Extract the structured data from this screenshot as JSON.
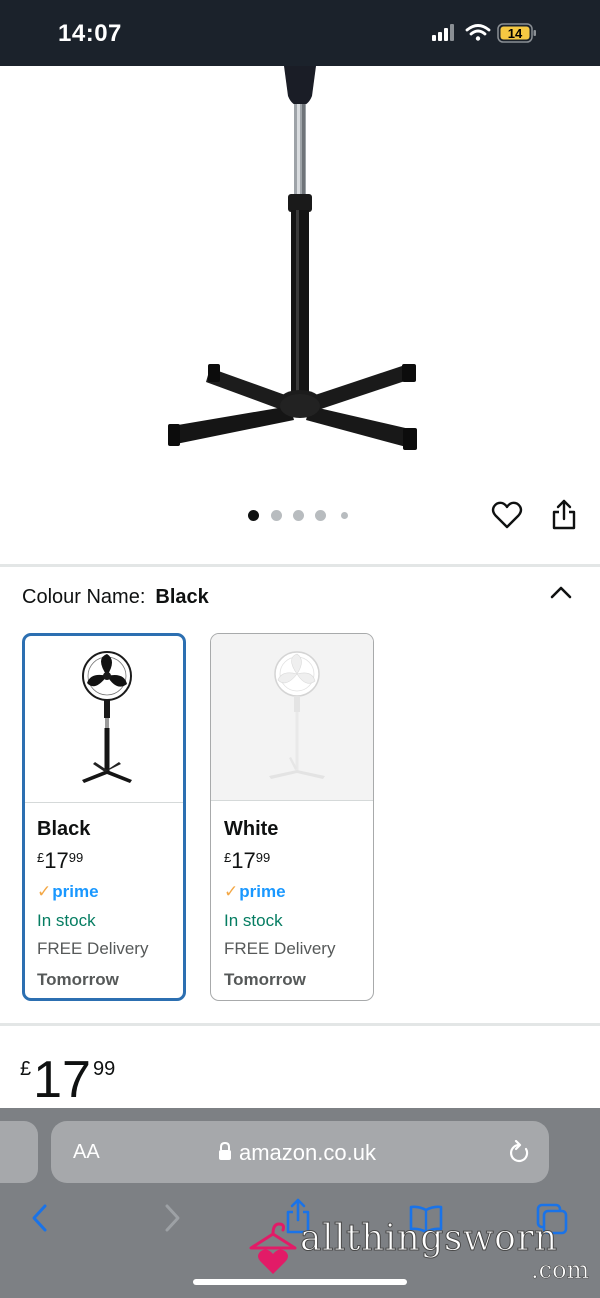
{
  "status_bar": {
    "time": "14:07",
    "battery_level": "14",
    "icons": [
      "cellular-signal-icon",
      "wifi-icon",
      "battery-icon"
    ]
  },
  "product": {
    "gallery": {
      "image_count": 5,
      "active_index": 0
    },
    "colour_label": "Colour Name:",
    "colour_value": "Black",
    "options": [
      {
        "name": "Black",
        "price_currency": "£",
        "price_whole": "17",
        "price_fraction": "99",
        "prime_label": "prime",
        "stock": "In stock",
        "delivery": "FREE Delivery",
        "delivery_day": "Tomorrow",
        "selected": true
      },
      {
        "name": "White",
        "price_currency": "£",
        "price_whole": "17",
        "price_fraction": "99",
        "prime_label": "prime",
        "stock": "In stock",
        "delivery": "FREE Delivery",
        "delivery_day": "Tomorrow",
        "selected": false
      }
    ],
    "price": {
      "currency": "£",
      "whole": "17",
      "fraction": "99"
    }
  },
  "browser": {
    "text_size_label": "AA",
    "url": "amazon.co.uk"
  },
  "watermark": {
    "text": "allthingsworn",
    "suffix": ".com"
  },
  "colors": {
    "status_bar_bg": "#1b222b",
    "selected_border": "#2c6fb1",
    "in_stock": "#067d62",
    "prime_blue": "#1a98ff",
    "prime_check": "#f3a847",
    "browser_bar_bg": "#7d8084",
    "ios_link_blue": "#1a73e8"
  }
}
